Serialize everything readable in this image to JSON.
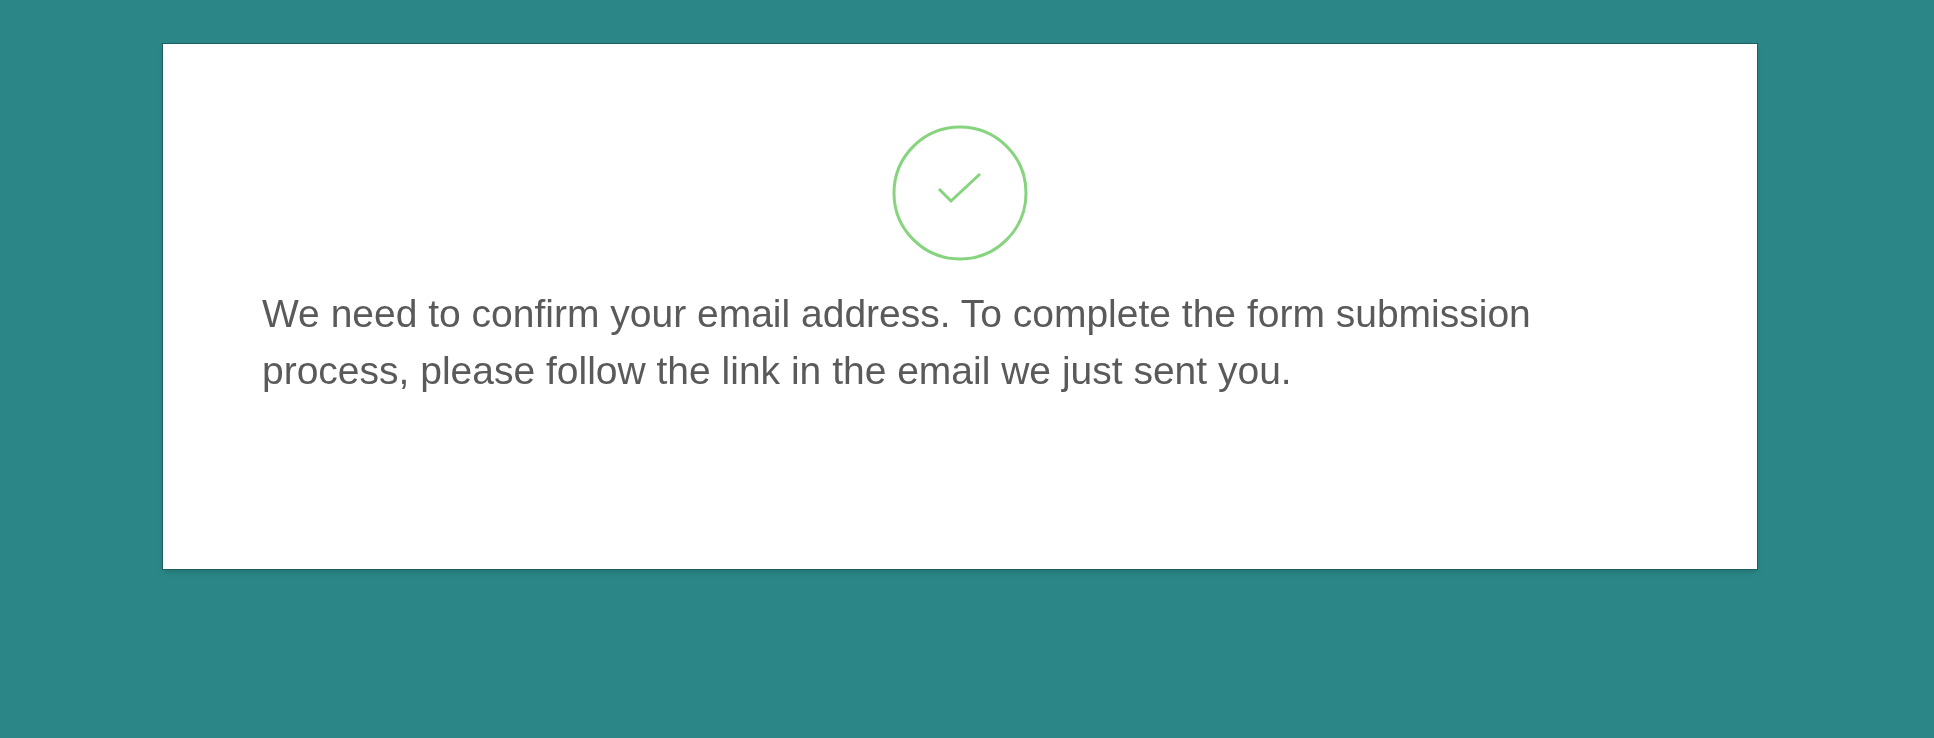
{
  "confirmation": {
    "message": "We need to confirm your email address. To complete the form submission process, please follow the link in the email we just sent you."
  }
}
